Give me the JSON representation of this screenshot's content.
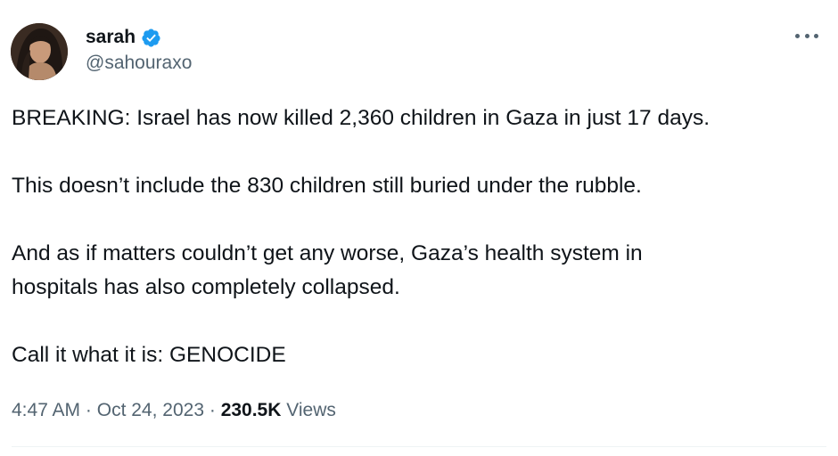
{
  "author": {
    "display_name": "sarah",
    "handle": "@sahouraxo",
    "verified": true,
    "avatar_icon": "user-avatar-photo"
  },
  "tweet": {
    "paragraphs": [
      "BREAKING: Israel has now killed 2,360 children in Gaza in just 17 days.",
      "This doesn’t include the 830 children still buried under the rubble.",
      "And as if matters couldn’t get any worse, Gaza’s health system in\nhospitals has also completely collapsed.",
      "Call it what it is: GENOCIDE"
    ],
    "time": "4:47 AM",
    "separator": "·",
    "date": "Oct 24, 2023",
    "views_count": "230.5K",
    "views_label": "Views"
  },
  "colors": {
    "verified_blue": "#1d9bf0",
    "secondary_text": "#536471",
    "primary_text": "#0f1419"
  },
  "icons": {
    "verified": "verified-badge-icon",
    "more": "more-options-icon"
  }
}
